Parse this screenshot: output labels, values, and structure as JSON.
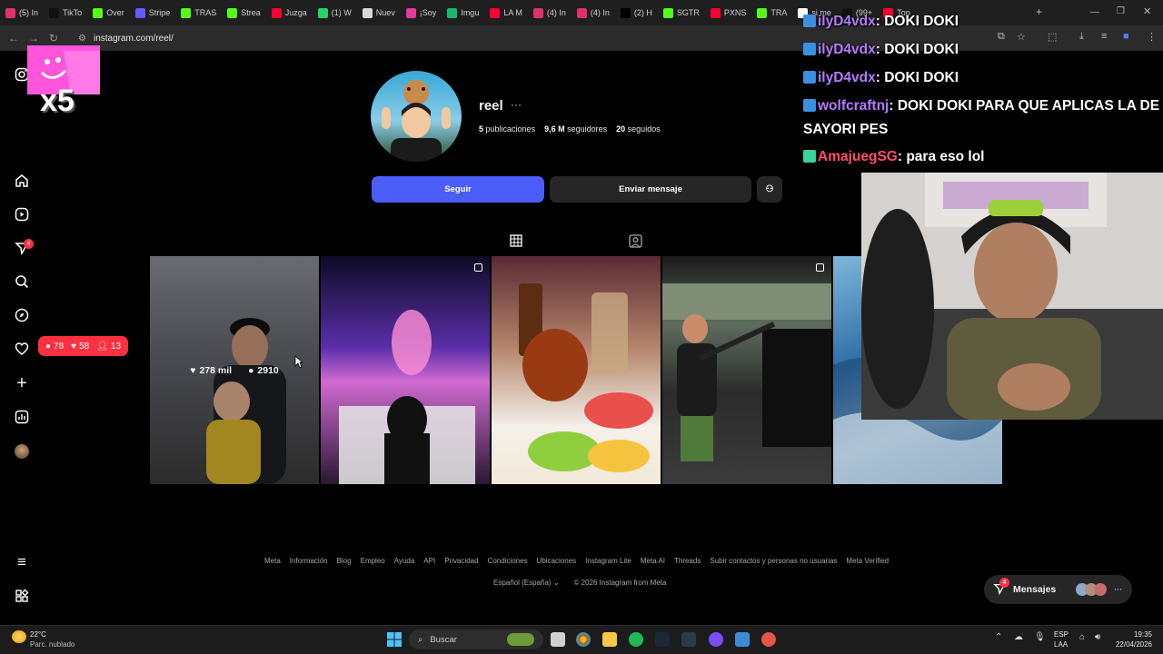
{
  "browser": {
    "tabs": [
      {
        "label": "(5) In",
        "color": "#e1306c"
      },
      {
        "label": "TikTo",
        "color": "#111111"
      },
      {
        "label": "Over",
        "color": "#53fc18"
      },
      {
        "label": "Stripe",
        "color": "#635bff"
      },
      {
        "label": "TRAS",
        "color": "#53fc18"
      },
      {
        "label": "Strea",
        "color": "#53fc18"
      },
      {
        "label": "Juzga",
        "color": "#ff0033"
      },
      {
        "label": "(1) W",
        "color": "#25d366"
      },
      {
        "label": "Nuev",
        "color": "#d8d8d8"
      },
      {
        "label": "¡Soy",
        "color": "#e13a9a"
      },
      {
        "label": "Imgu",
        "color": "#1bb76e"
      },
      {
        "label": "LA M",
        "color": "#ff0033"
      },
      {
        "label": "(4) In",
        "color": "#e1306c"
      },
      {
        "label": "(4) In",
        "color": "#e1306c"
      },
      {
        "label": "(2) H",
        "color": "#000000"
      },
      {
        "label": "SGTR",
        "color": "#53fc18"
      },
      {
        "label": "PXNS",
        "color": "#ff0033"
      },
      {
        "label": "TRA",
        "color": "#53fc18"
      },
      {
        "label": "si me",
        "color": "#ffffff"
      },
      {
        "label": "(99+",
        "color": "#111111"
      },
      {
        "label": "Top",
        "color": "#ff0033"
      }
    ],
    "url": "instagram.com/reel/"
  },
  "profile": {
    "username": "reel",
    "more": "···",
    "posts_count": "5",
    "posts_label": "publicaciones",
    "followers_count": "9,6 M",
    "followers_label": "seguidores",
    "following_count": "20",
    "following_label": "seguidos",
    "follow_button": "Seguir",
    "message_button": "Enviar mensaje"
  },
  "sidebar": {
    "notifications_badge": "4",
    "pill": {
      "comments": "78",
      "likes": "58",
      "follows": "13"
    }
  },
  "posts": [
    {
      "likes": "278 mil",
      "comments": "2910",
      "hovered": true,
      "multi": false
    },
    {
      "hovered": false,
      "multi": true
    },
    {
      "hovered": false,
      "multi": false
    },
    {
      "hovered": false,
      "multi": true
    },
    {
      "hovered": false,
      "multi": false
    }
  ],
  "footer": {
    "links": [
      "Meta",
      "Información",
      "Blog",
      "Empleo",
      "Ayuda",
      "API",
      "Privacidad",
      "Condiciones",
      "Ubicaciones",
      "Instagram Lite",
      "Meta AI",
      "Threads",
      "Subir contactos y personas no usuarias",
      "Meta Verified"
    ],
    "language": "Español (España)",
    "copyright": "© 2026 Instagram from Meta"
  },
  "messages": {
    "label": "Mensajes",
    "badge": "4"
  },
  "stream": {
    "x5_label": "x5",
    "chat": [
      {
        "user": "ilyD4vdx",
        "msg": ": DOKI DOKI",
        "red": false
      },
      {
        "user": "ilyD4vdx",
        "msg": ": DOKI DOKI",
        "red": false
      },
      {
        "user": "ilyD4vdx",
        "msg": ": DOKI DOKI",
        "red": false
      },
      {
        "user": "wolfcraftnj",
        "msg": ": DOKI DOKI PARA QUE APLICAS LA DE",
        "red": false
      },
      {
        "user": "",
        "msg": "SAYORI PES",
        "red": false
      },
      {
        "user": "AmajuegSG",
        "msg": ": para eso lol",
        "red": true
      }
    ]
  },
  "taskbar": {
    "weather_temp": "22°C",
    "weather_desc": "Parc. nublado",
    "search": "Buscar",
    "lang_top": "ESP",
    "lang_bottom": "LAA",
    "time": "19:35",
    "date": "22/04/2026"
  }
}
